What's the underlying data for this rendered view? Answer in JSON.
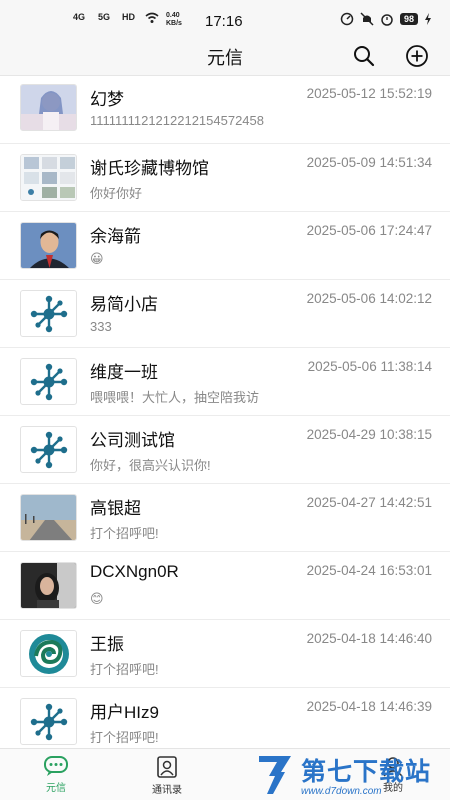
{
  "status_bar": {
    "network_1": "4G",
    "network_2": "5G",
    "hd": "HD",
    "speed": "0.40 KB/s",
    "time": "17:16",
    "battery": "98"
  },
  "header": {
    "title": "元信"
  },
  "conversations": [
    {
      "name": "幻梦",
      "time": "2025-05-12 15:52:19",
      "preview": "1111111121212212154572458",
      "avatar": "anime-photo"
    },
    {
      "name": "谢氏珍藏博物馆",
      "time": "2025-05-09 14:51:34",
      "preview": "你好你好",
      "avatar": "photo-grid"
    },
    {
      "name": "余海箭",
      "time": "2025-05-06 17:24:47",
      "preview": "😀",
      "avatar": "man-photo"
    },
    {
      "name": "易简小店",
      "time": "2025-05-06 14:02:12",
      "preview": "333",
      "avatar": "molecule-logo"
    },
    {
      "name": "维度一班",
      "time": "2025-05-06 11:38:14",
      "preview": "喂喂喂！大忙人，抽空陪我访",
      "avatar": "molecule-logo"
    },
    {
      "name": "公司测试馆",
      "time": "2025-04-29 10:38:15",
      "preview": "你好，很高兴认识你!",
      "avatar": "molecule-logo"
    },
    {
      "name": "高银超",
      "time": "2025-04-27 14:42:51",
      "preview": "打个招呼吧!",
      "avatar": "road-photo"
    },
    {
      "name": "DCXNgn0R",
      "time": "2025-04-24 16:53:01",
      "preview": "😊",
      "avatar": "woman-photo"
    },
    {
      "name": "王振",
      "time": "2025-04-18 14:46:40",
      "preview": "打个招呼吧!",
      "avatar": "swirl-logo"
    },
    {
      "name": "用户HIz9",
      "time": "2025-04-18 14:46:39",
      "preview": "打个招呼吧!",
      "avatar": "molecule-logo"
    }
  ],
  "tabbar": {
    "tabs": [
      {
        "label": "元信",
        "icon": "chat-icon",
        "active": true
      },
      {
        "label": "通讯录",
        "icon": "contacts-icon",
        "active": false
      },
      {
        "label": "我的",
        "icon": "profile-icon",
        "active": false
      }
    ]
  },
  "watermark": {
    "text": "第七下载站",
    "url": "www.d7down.com"
  },
  "colors": {
    "accent_green": "#2aa160",
    "molecule_blue": "#1e6e8c",
    "watermark_blue": "#2a74c8"
  }
}
